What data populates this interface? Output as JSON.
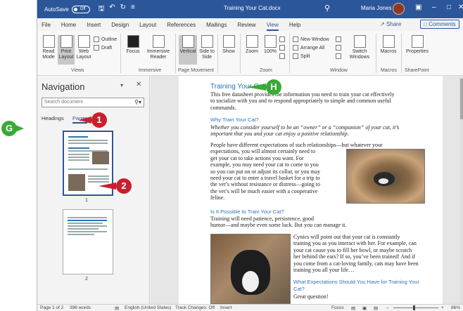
{
  "titlebar": {
    "autosave_label": "AutoSave",
    "autosave_state": "Off",
    "doc_title": "Training Your Cat.docx",
    "user_name": "Maria Jones",
    "qat_icons": [
      "save-icon",
      "undo-icon",
      "redo-icon",
      "customize-icon"
    ],
    "window_controls": [
      "ribbon-display-icon",
      "minimize-icon",
      "maximize-icon",
      "close-icon"
    ]
  },
  "tabs": [
    "File",
    "Home",
    "Insert",
    "Design",
    "Layout",
    "References",
    "Mailings",
    "Review",
    "View",
    "Help"
  ],
  "active_tab": "View",
  "share_label": "Share",
  "comments_label": "Comments",
  "ribbon": {
    "views": {
      "label": "Views",
      "read_mode": "Read Mode",
      "print_layout": "Print Layout",
      "web_layout": "Web Layout",
      "outline": "Outline",
      "draft": "Draft"
    },
    "immersive": {
      "label": "Immersive",
      "focus": "Focus",
      "immersive_reader": "Immersive Reader"
    },
    "page_movement": {
      "label": "Page Movement",
      "vertical": "Vertical",
      "side_to_side": "Side to Side"
    },
    "show": {
      "label": "Show"
    },
    "zoom": {
      "label": "Zoom",
      "zoom": "Zoom",
      "hundred": "100%"
    },
    "window": {
      "label": "Window",
      "new_window": "New Window",
      "arrange_all": "Arrange All",
      "split": "Split",
      "switch_windows": "Switch Windows"
    },
    "macros": {
      "label": "Macros",
      "macros": "Macros"
    },
    "sharepoint": {
      "label": "SharePoint",
      "properties": "Properties"
    }
  },
  "navigation": {
    "title": "Navigation",
    "search_placeholder": "Search document",
    "tabs": [
      "Headings",
      "Pages"
    ],
    "active_tab": "Pages",
    "pages": [
      "1",
      "2"
    ]
  },
  "document": {
    "title": "Training Your Cat",
    "intro": [
      "This free datasheet provides the information you need to train your cat effectively",
      "to socialize with you and to respond appropriately to simple and common useful",
      "commands."
    ],
    "h2": "Why Train Your Cat?",
    "h2_italic": [
      "Whether you consider yourself to be an “owner” or a “companion” of your cat, it’s",
      "important that you and your cat enjoy a positive relationship."
    ],
    "para2": [
      "People have different expectations of such relationships—but whatever your",
      "expectations, you will almost certainly need to",
      "get your cat to take actions you want. For",
      "example, you may need your cat to come to you",
      "so you can put on or adjust its collar, or you may",
      "need your cat to enter a travel basket for a trip to",
      "the vet’s without resistance or distress—going to",
      "the vet’s will be much easier with a cooperative",
      "feline."
    ],
    "h3": "Is It Possible to Train Your Cat?",
    "para3": [
      "Training will need patience, persistence, good",
      "humor—and maybe even some luck. But you can manage it."
    ],
    "para4": [
      "Cynics will point out that your cat is constantly",
      "training you as you interact with her. For example, can",
      "your cat cause you to fill her bowl, or maybe scratch",
      "her behind the ears? If so, you’ve been trained! And if",
      "you come from a cat-loving family, cats may have been",
      "training you all your life…"
    ],
    "h4": [
      "What Expectations Should You Have for Training Your",
      "Cat?"
    ],
    "para5": "Great question!"
  },
  "statusbar": {
    "page": "Page 1 of 2",
    "words": "396 words",
    "language": "English (United States)",
    "track_changes": "Track Changes: Off",
    "mode": "Insert",
    "focus": "Focus",
    "zoom": "86%"
  },
  "callouts": [
    "G",
    "1",
    "2",
    "H"
  ],
  "colors": {
    "accent": "#2b579a",
    "heading": "#2e74b5",
    "callout_red": "#c8202f",
    "callout_green": "#3aaa35"
  }
}
